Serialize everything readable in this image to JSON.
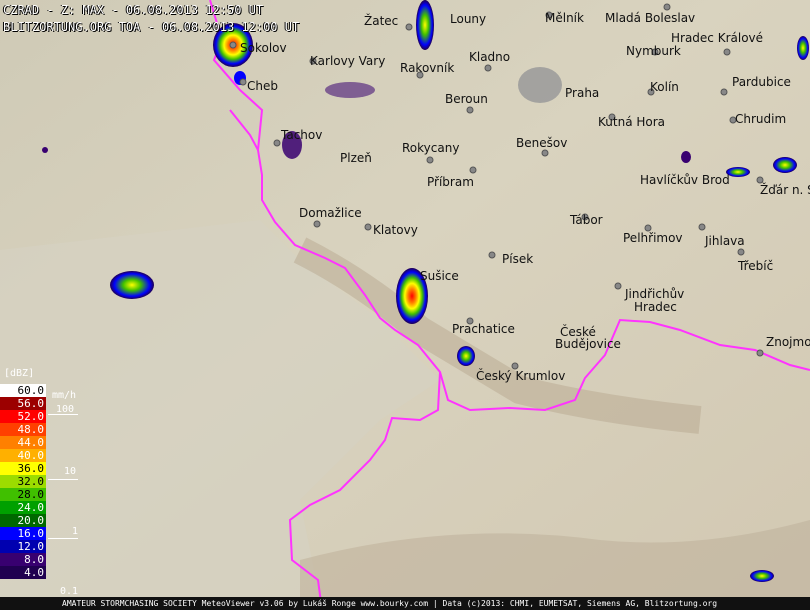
{
  "header": {
    "line1": "CZRAD - Z: MAX - 06.08.2013 12:50 UT",
    "line2": "BLITZORTUNG.ORG TOA - 06.08.2013 12:00 UT"
  },
  "cities": [
    {
      "name": "Žatec"
    },
    {
      "name": "Louny"
    },
    {
      "name": "Mělník"
    },
    {
      "name": "Mladá Boleslav"
    },
    {
      "name": "Sokolov"
    },
    {
      "name": "Karlovy Vary"
    },
    {
      "name": "Hradec Králové"
    },
    {
      "name": "Kladno"
    },
    {
      "name": "Nymburk"
    },
    {
      "name": "Cheb"
    },
    {
      "name": "Rakovník"
    },
    {
      "name": "Pardubice"
    },
    {
      "name": "Kolín"
    },
    {
      "name": "Praha"
    },
    {
      "name": "Beroun"
    },
    {
      "name": "Chrudim"
    },
    {
      "name": "Tachov"
    },
    {
      "name": "Kutná Hora"
    },
    {
      "name": "Rokycany"
    },
    {
      "name": "Benešov"
    },
    {
      "name": "Plzeň"
    },
    {
      "name": "Příbram"
    },
    {
      "name": "Havlíčkův Brod"
    },
    {
      "name": "Žďár n. S"
    },
    {
      "name": "Domažlice"
    },
    {
      "name": "Tábor"
    },
    {
      "name": "Klatovy"
    },
    {
      "name": "Pelhřimov"
    },
    {
      "name": "Jihlava"
    },
    {
      "name": "Písek"
    },
    {
      "name": "Sušice"
    },
    {
      "name": "Třebíč"
    },
    {
      "name": "Jindřichův"
    },
    {
      "name": "Hradec"
    },
    {
      "name": "Prachatice"
    },
    {
      "name": "České"
    },
    {
      "name": "Budějovice"
    },
    {
      "name": "Znojmo"
    },
    {
      "name": "Český Krumlov"
    }
  ],
  "legend": {
    "unit_dbz": "[dBZ]",
    "unit_rate": "mm/h",
    "steps": [
      {
        "label": "60.0",
        "color": "#ffffff",
        "text": "#000000"
      },
      {
        "label": "56.0",
        "color": "#9c0000",
        "text": "#ffffff"
      },
      {
        "label": "52.0",
        "color": "#ff0000",
        "text": "#ffffff"
      },
      {
        "label": "48.0",
        "color": "#ff4000",
        "text": "#ffffff"
      },
      {
        "label": "44.0",
        "color": "#ff8000",
        "text": "#ffffff"
      },
      {
        "label": "40.0",
        "color": "#ffb000",
        "text": "#ffffff"
      },
      {
        "label": "36.0",
        "color": "#ffff00",
        "text": "#000000"
      },
      {
        "label": "32.0",
        "color": "#9cdc00",
        "text": "#000000"
      },
      {
        "label": "28.0",
        "color": "#40c000",
        "text": "#000000"
      },
      {
        "label": "24.0",
        "color": "#00a000",
        "text": "#ffffff"
      },
      {
        "label": "20.0",
        "color": "#006800",
        "text": "#ffffff"
      },
      {
        "label": "16.0",
        "color": "#0000ff",
        "text": "#ffffff"
      },
      {
        "label": "12.0",
        "color": "#0000b0",
        "text": "#ffffff"
      },
      {
        "label": "8.0",
        "color": "#380070",
        "text": "#ffffff"
      },
      {
        "label": "4.0",
        "color": "#200050",
        "text": "#ffffff"
      }
    ],
    "rates": [
      "100",
      "10",
      "1",
      "0.1"
    ]
  },
  "footer": "AMATEUR STORMCHASING SOCIETY MeteoViewer v3.06 by Lukáš Ronge www.bourky.com | Data (c)2013: CHMI, EUMETSAT, Siemens AG, Blitzortung.org",
  "colors": {
    "border": "#ff33ff",
    "terrain": "#c9c2b0"
  }
}
